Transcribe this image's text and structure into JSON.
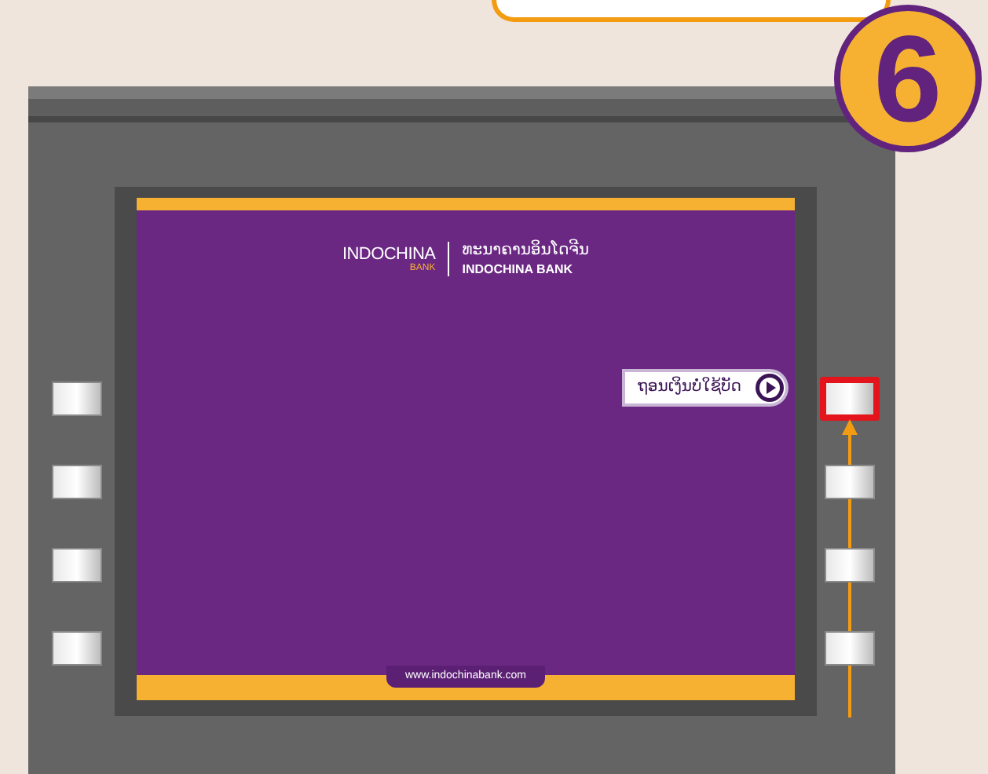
{
  "step_badge": "6",
  "bank_logo": {
    "brand": "INDOCHINA",
    "brand_sub": "BANK",
    "name_lao": "ທະນາຄານອິນໂດຈີນ",
    "name_en": "INDOCHINA BANK"
  },
  "option": {
    "label": "ຖອນເງິນບໍ່ໃຊ້ບັດ"
  },
  "side_buttons": {
    "left": [
      {
        "highlighted": false
      },
      {
        "highlighted": false
      },
      {
        "highlighted": false
      },
      {
        "highlighted": false
      }
    ],
    "right": [
      {
        "highlighted": true
      },
      {
        "highlighted": false
      },
      {
        "highlighted": false
      },
      {
        "highlighted": false
      }
    ]
  },
  "footer_url": "www.indochinabank.com"
}
